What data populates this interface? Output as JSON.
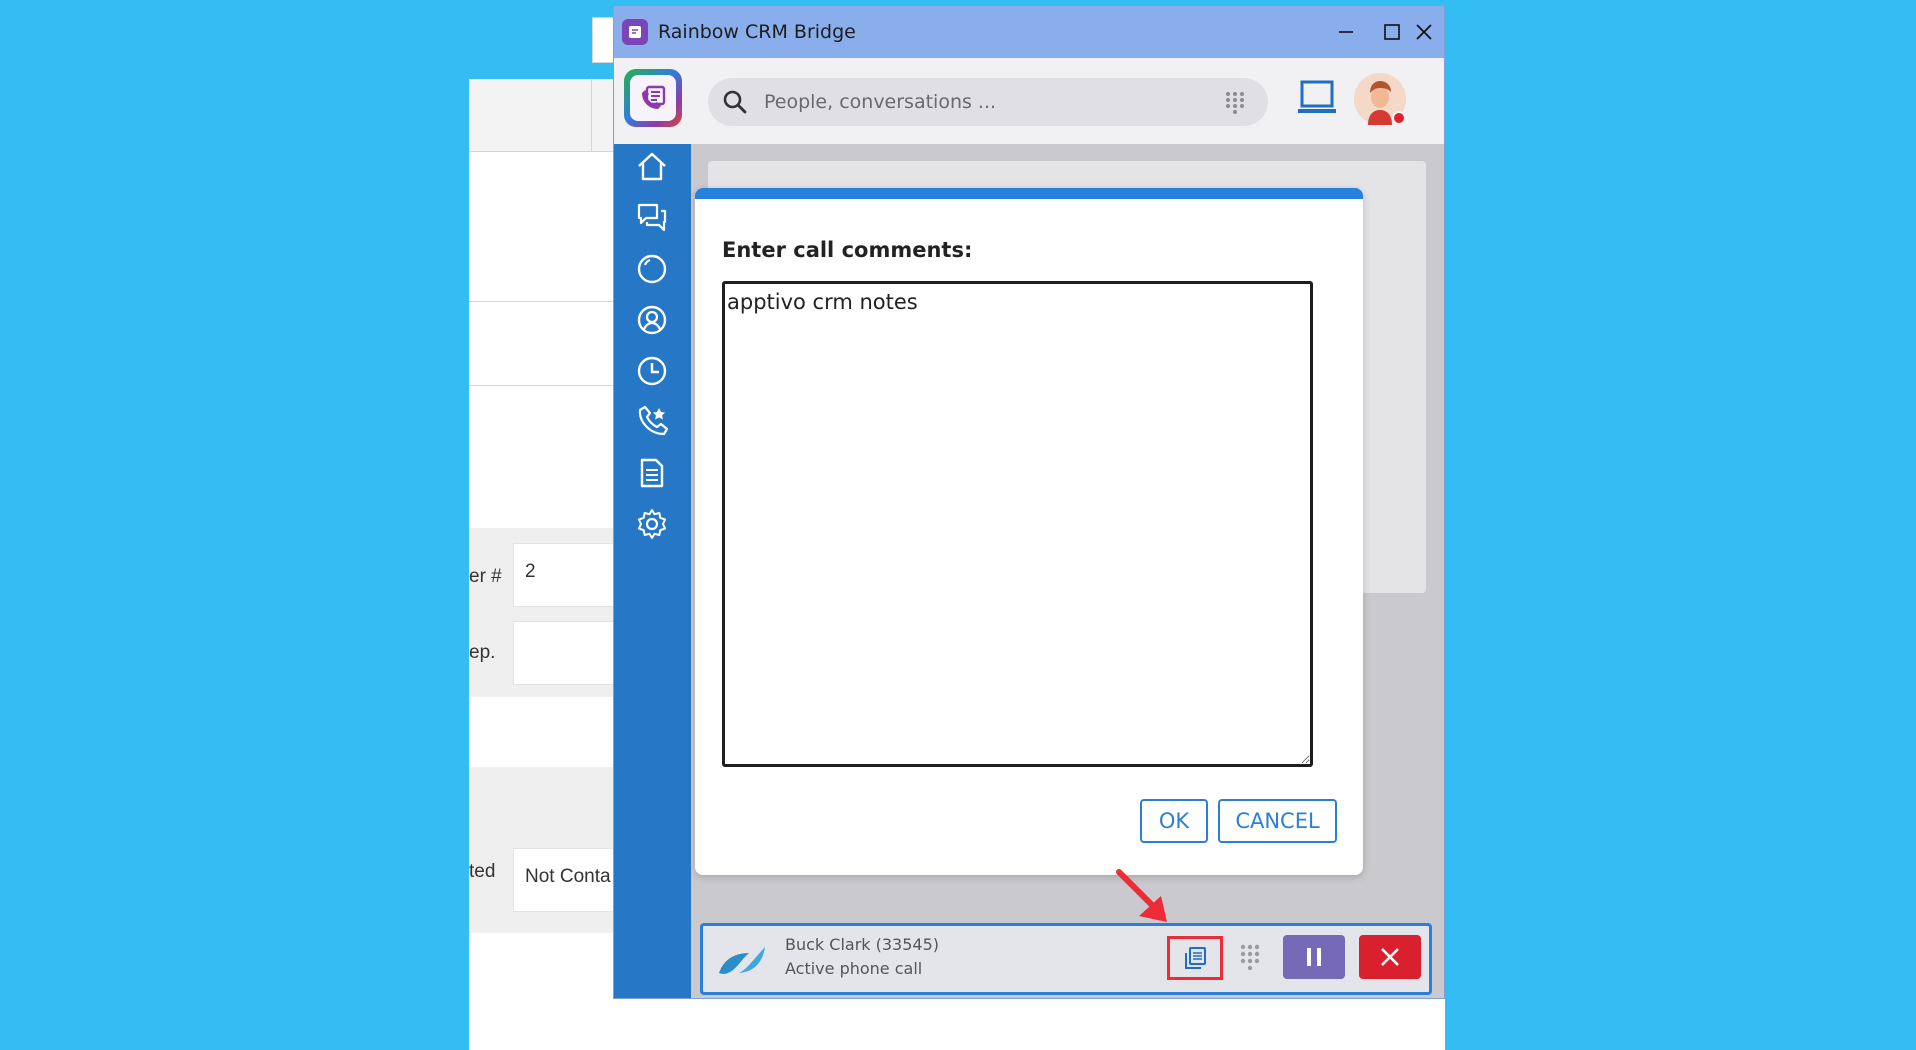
{
  "window": {
    "title": "Rainbow CRM Bridge"
  },
  "search": {
    "placeholder": "People, conversations ..."
  },
  "sidebar": {
    "items": [
      {
        "icon": "home-icon"
      },
      {
        "icon": "conversations-icon"
      },
      {
        "icon": "bubbles-icon"
      },
      {
        "icon": "contacts-icon"
      },
      {
        "icon": "history-icon"
      },
      {
        "icon": "favorite-calls-icon"
      },
      {
        "icon": "documents-icon"
      },
      {
        "icon": "settings-icon"
      }
    ]
  },
  "dialog": {
    "label": "Enter call comments:",
    "text": "apptivo crm notes",
    "ok_label": "OK",
    "cancel_label": "CANCEL"
  },
  "call": {
    "caller": "Buck Clark (33545)",
    "status": "Active phone call"
  },
  "background_page": {
    "labels": [
      "er #",
      "ep.",
      "ted"
    ],
    "values": [
      "2",
      "",
      "Not Conta"
    ]
  },
  "colors": {
    "desktop": "#33bdf2",
    "titlebar": "#89aeeb",
    "sidebar": "#2678c7",
    "accent": "#2c7fd4",
    "hold": "#7569b8",
    "hangup": "#d8202f",
    "highlight": "#ee2b37"
  }
}
